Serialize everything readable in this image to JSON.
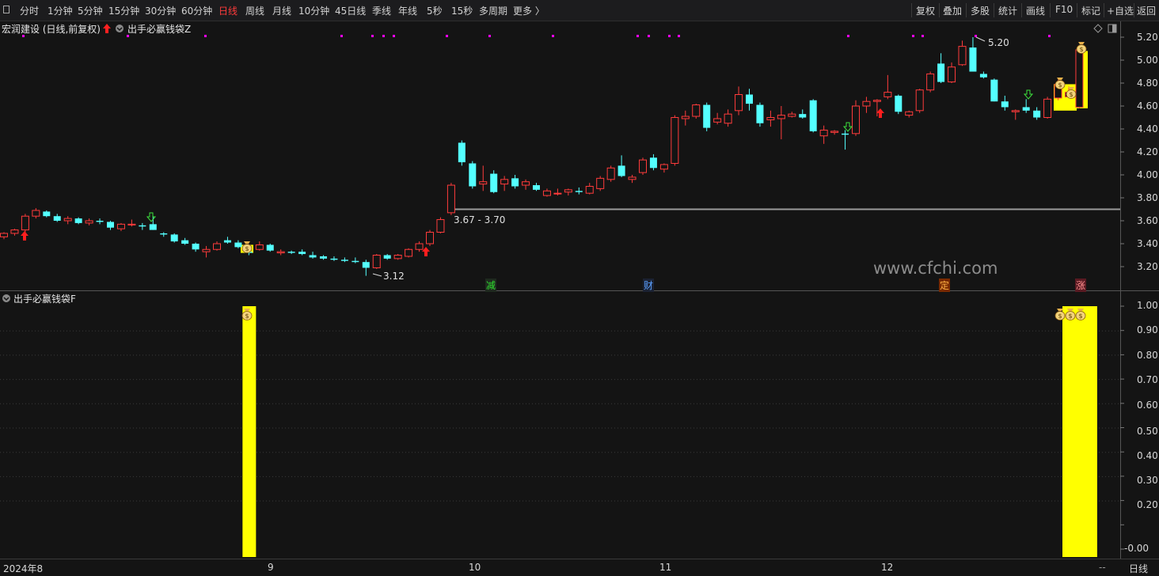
{
  "toolbar": {
    "periods": [
      "分时",
      "1分钟",
      "5分钟",
      "15分钟",
      "30分钟",
      "60分钟",
      "日线",
      "周线",
      "月线",
      "10分钟",
      "45日线",
      "季线",
      "年线",
      "5秒",
      "15秒",
      "多周期",
      "更多 〉"
    ],
    "active_period": "日线",
    "right_buttons": [
      "复权",
      "叠加",
      "多股",
      "统计",
      "画线",
      "F10",
      "标记",
      "+自选",
      "返回"
    ]
  },
  "main_pane": {
    "stock_name": "宏润建设 (日线,前复权)",
    "indicator_name": "出手必赢钱袋Z",
    "y_ticks": [
      "5.20",
      "5.00",
      "4.80",
      "4.60",
      "4.40",
      "4.20",
      "4.00",
      "3.80",
      "3.60",
      "3.40",
      "3.20"
    ],
    "high_label": "5.20",
    "low_label": "3.12",
    "range_label": "3.67 - 3.70",
    "event_markers": [
      "减",
      "财",
      "定",
      "涨"
    ],
    "watermark": "www.cfchi.com"
  },
  "sub_pane": {
    "indicator_name": "出手必赢钱袋F",
    "y_ticks": [
      "1.00",
      "0.90",
      "0.80",
      "0.70",
      "0.60",
      "0.50",
      "0.40",
      "0.30",
      "0.20",
      "-0.00"
    ]
  },
  "x_axis": {
    "labels": [
      "2024年8",
      "9",
      "10",
      "11",
      "12"
    ],
    "period": "日线",
    "nav": "--"
  },
  "colors": {
    "up": "#ff3b3b",
    "down": "#54ffff",
    "signal": "#ffff00",
    "marker": "#ff00ff",
    "background": "#141414"
  },
  "chart_data": [
    {
      "type": "candlestick",
      "title": "宏润建设 (日线,前复权)",
      "ylim": [
        3.05,
        5.28
      ],
      "ohlc": [
        [
          3.46,
          3.5,
          3.44,
          3.49
        ],
        [
          3.49,
          3.53,
          3.47,
          3.52
        ],
        [
          3.52,
          3.66,
          3.5,
          3.64
        ],
        [
          3.64,
          3.71,
          3.62,
          3.69
        ],
        [
          3.68,
          3.69,
          3.63,
          3.64
        ],
        [
          3.64,
          3.66,
          3.59,
          3.6
        ],
        [
          3.6,
          3.64,
          3.57,
          3.62
        ],
        [
          3.62,
          3.63,
          3.57,
          3.58
        ],
        [
          3.58,
          3.62,
          3.56,
          3.6
        ],
        [
          3.6,
          3.62,
          3.57,
          3.59
        ],
        [
          3.59,
          3.6,
          3.52,
          3.54
        ],
        [
          3.53,
          3.58,
          3.51,
          3.57
        ],
        [
          3.57,
          3.61,
          3.55,
          3.57
        ],
        [
          3.56,
          3.58,
          3.52,
          3.55
        ],
        [
          3.57,
          3.64,
          3.52,
          3.52
        ],
        [
          3.49,
          3.5,
          3.46,
          3.48
        ],
        [
          3.48,
          3.49,
          3.41,
          3.42
        ],
        [
          3.43,
          3.45,
          3.39,
          3.4
        ],
        [
          3.4,
          3.41,
          3.33,
          3.35
        ],
        [
          3.33,
          3.38,
          3.28,
          3.35
        ],
        [
          3.35,
          3.42,
          3.34,
          3.4
        ],
        [
          3.43,
          3.46,
          3.4,
          3.41
        ],
        [
          3.41,
          3.43,
          3.36,
          3.37
        ],
        [
          3.33,
          3.36,
          3.3,
          3.32
        ],
        [
          3.35,
          3.42,
          3.34,
          3.39
        ],
        [
          3.39,
          3.4,
          3.33,
          3.34
        ],
        [
          3.32,
          3.35,
          3.3,
          3.33
        ],
        [
          3.33,
          3.34,
          3.31,
          3.32
        ],
        [
          3.33,
          3.35,
          3.3,
          3.31
        ],
        [
          3.3,
          3.33,
          3.27,
          3.28
        ],
        [
          3.29,
          3.3,
          3.26,
          3.27
        ],
        [
          3.27,
          3.29,
          3.25,
          3.26
        ],
        [
          3.26,
          3.28,
          3.24,
          3.25
        ],
        [
          3.25,
          3.28,
          3.23,
          3.24
        ],
        [
          3.24,
          3.26,
          3.12,
          3.19
        ],
        [
          3.19,
          3.31,
          3.18,
          3.3
        ],
        [
          3.3,
          3.31,
          3.26,
          3.27
        ],
        [
          3.27,
          3.31,
          3.26,
          3.3
        ],
        [
          3.29,
          3.36,
          3.28,
          3.35
        ],
        [
          3.35,
          3.42,
          3.33,
          3.4
        ],
        [
          3.4,
          3.52,
          3.38,
          3.5
        ],
        [
          3.5,
          3.63,
          3.49,
          3.61
        ],
        [
          3.67,
          3.93,
          3.65,
          3.91
        ],
        [
          4.28,
          4.3,
          4.08,
          4.11
        ],
        [
          4.1,
          4.12,
          3.88,
          3.9
        ],
        [
          3.92,
          4.08,
          3.86,
          3.94
        ],
        [
          4.01,
          4.04,
          3.84,
          3.85
        ],
        [
          3.92,
          3.99,
          3.86,
          3.96
        ],
        [
          3.97,
          4.0,
          3.88,
          3.9
        ],
        [
          3.91,
          3.96,
          3.87,
          3.94
        ],
        [
          3.91,
          3.93,
          3.86,
          3.87
        ],
        [
          3.82,
          3.88,
          3.81,
          3.86
        ],
        [
          3.84,
          3.88,
          3.82,
          3.84
        ],
        [
          3.85,
          3.88,
          3.82,
          3.87
        ],
        [
          3.86,
          3.89,
          3.83,
          3.85
        ],
        [
          3.84,
          3.93,
          3.83,
          3.9
        ],
        [
          3.88,
          3.99,
          3.86,
          3.97
        ],
        [
          3.96,
          4.08,
          3.94,
          4.06
        ],
        [
          4.08,
          4.17,
          3.98,
          3.99
        ],
        [
          3.96,
          4.0,
          3.93,
          3.98
        ],
        [
          4.02,
          4.15,
          4.0,
          4.13
        ],
        [
          4.15,
          4.18,
          4.04,
          4.06
        ],
        [
          4.05,
          4.1,
          4.02,
          4.09
        ],
        [
          4.1,
          4.52,
          4.08,
          4.5
        ],
        [
          4.49,
          4.56,
          4.43,
          4.51
        ],
        [
          4.51,
          4.62,
          4.49,
          4.61
        ],
        [
          4.61,
          4.63,
          4.38,
          4.41
        ],
        [
          4.46,
          4.54,
          4.44,
          4.49
        ],
        [
          4.45,
          4.57,
          4.42,
          4.53
        ],
        [
          4.56,
          4.77,
          4.52,
          4.7
        ],
        [
          4.7,
          4.75,
          4.56,
          4.62
        ],
        [
          4.61,
          4.63,
          4.42,
          4.45
        ],
        [
          4.48,
          4.56,
          4.42,
          4.5
        ],
        [
          4.49,
          4.6,
          4.31,
          4.52
        ],
        [
          4.51,
          4.55,
          4.5,
          4.53
        ],
        [
          4.53,
          4.57,
          4.49,
          4.5
        ],
        [
          4.65,
          4.66,
          4.37,
          4.38
        ],
        [
          4.34,
          4.43,
          4.27,
          4.39
        ],
        [
          4.37,
          4.39,
          4.35,
          4.38
        ],
        [
          4.36,
          4.39,
          4.22,
          4.35
        ],
        [
          4.36,
          4.65,
          4.34,
          4.6
        ],
        [
          4.6,
          4.68,
          4.54,
          4.64
        ],
        [
          4.64,
          4.66,
          4.51,
          4.65
        ],
        [
          4.68,
          4.87,
          4.66,
          4.72
        ],
        [
          4.69,
          4.7,
          4.53,
          4.55
        ],
        [
          4.52,
          4.56,
          4.5,
          4.55
        ],
        [
          4.56,
          4.75,
          4.54,
          4.74
        ],
        [
          4.74,
          4.9,
          4.72,
          4.88
        ],
        [
          4.97,
          5.06,
          4.8,
          4.81
        ],
        [
          4.81,
          4.98,
          4.8,
          4.94
        ],
        [
          4.96,
          5.17,
          4.95,
          5.12
        ],
        [
          5.11,
          5.2,
          4.9,
          4.9
        ],
        [
          4.88,
          4.9,
          4.84,
          4.85
        ],
        [
          4.83,
          4.84,
          4.64,
          4.64
        ],
        [
          4.64,
          4.69,
          4.56,
          4.59
        ],
        [
          4.55,
          4.57,
          4.48,
          4.56
        ],
        [
          4.59,
          4.66,
          4.54,
          4.56
        ],
        [
          4.56,
          4.59,
          4.48,
          4.5
        ],
        [
          4.5,
          4.68,
          4.49,
          4.66
        ],
        [
          4.67,
          4.83,
          4.65,
          4.79
        ],
        [
          4.68,
          4.77,
          4.67,
          4.72
        ],
        [
          4.59,
          5.12,
          4.58,
          5.09
        ]
      ]
    },
    {
      "type": "bar",
      "title": "出手必赢钱袋F",
      "ylim": [
        0,
        1
      ],
      "signals": [
        23,
        100,
        101,
        102
      ],
      "value": 1.0
    }
  ]
}
